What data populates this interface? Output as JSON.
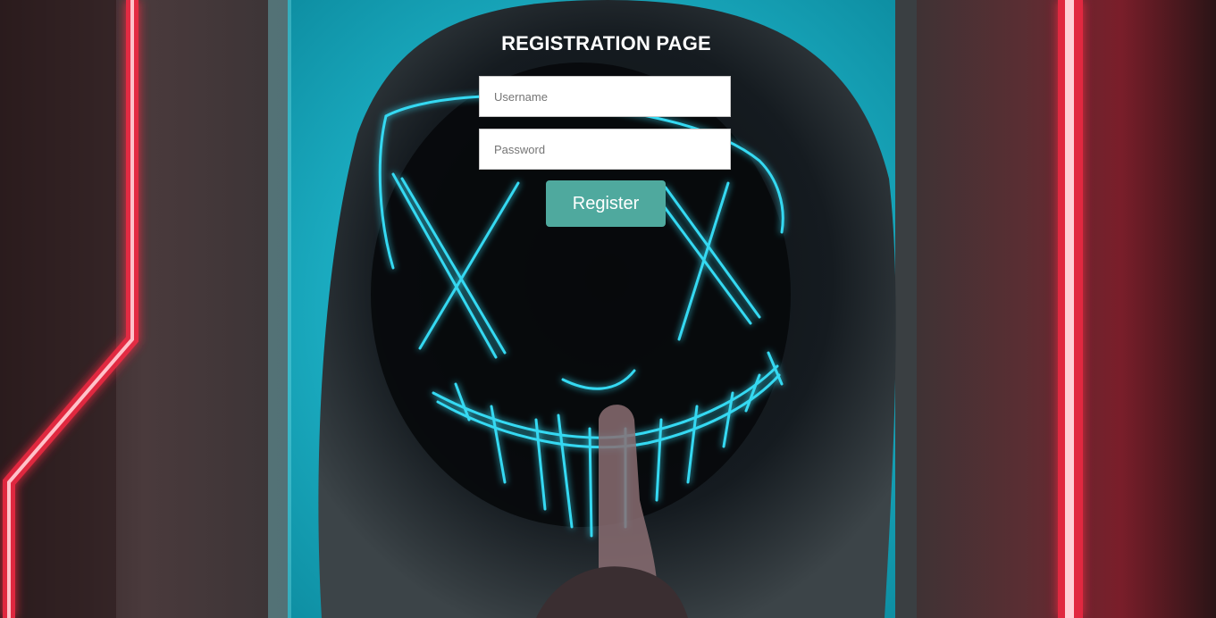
{
  "page": {
    "title": "REGISTRATION PAGE"
  },
  "form": {
    "username_placeholder": "Username",
    "password_placeholder": "Password",
    "register_label": "Register"
  },
  "colors": {
    "button": "#4fa99e",
    "title": "#ffffff",
    "neon_red": "#ff2a45",
    "neon_cyan": "#2fd8ee"
  },
  "background": {
    "description_icon": "hooded-figure-neon-mask-image"
  }
}
